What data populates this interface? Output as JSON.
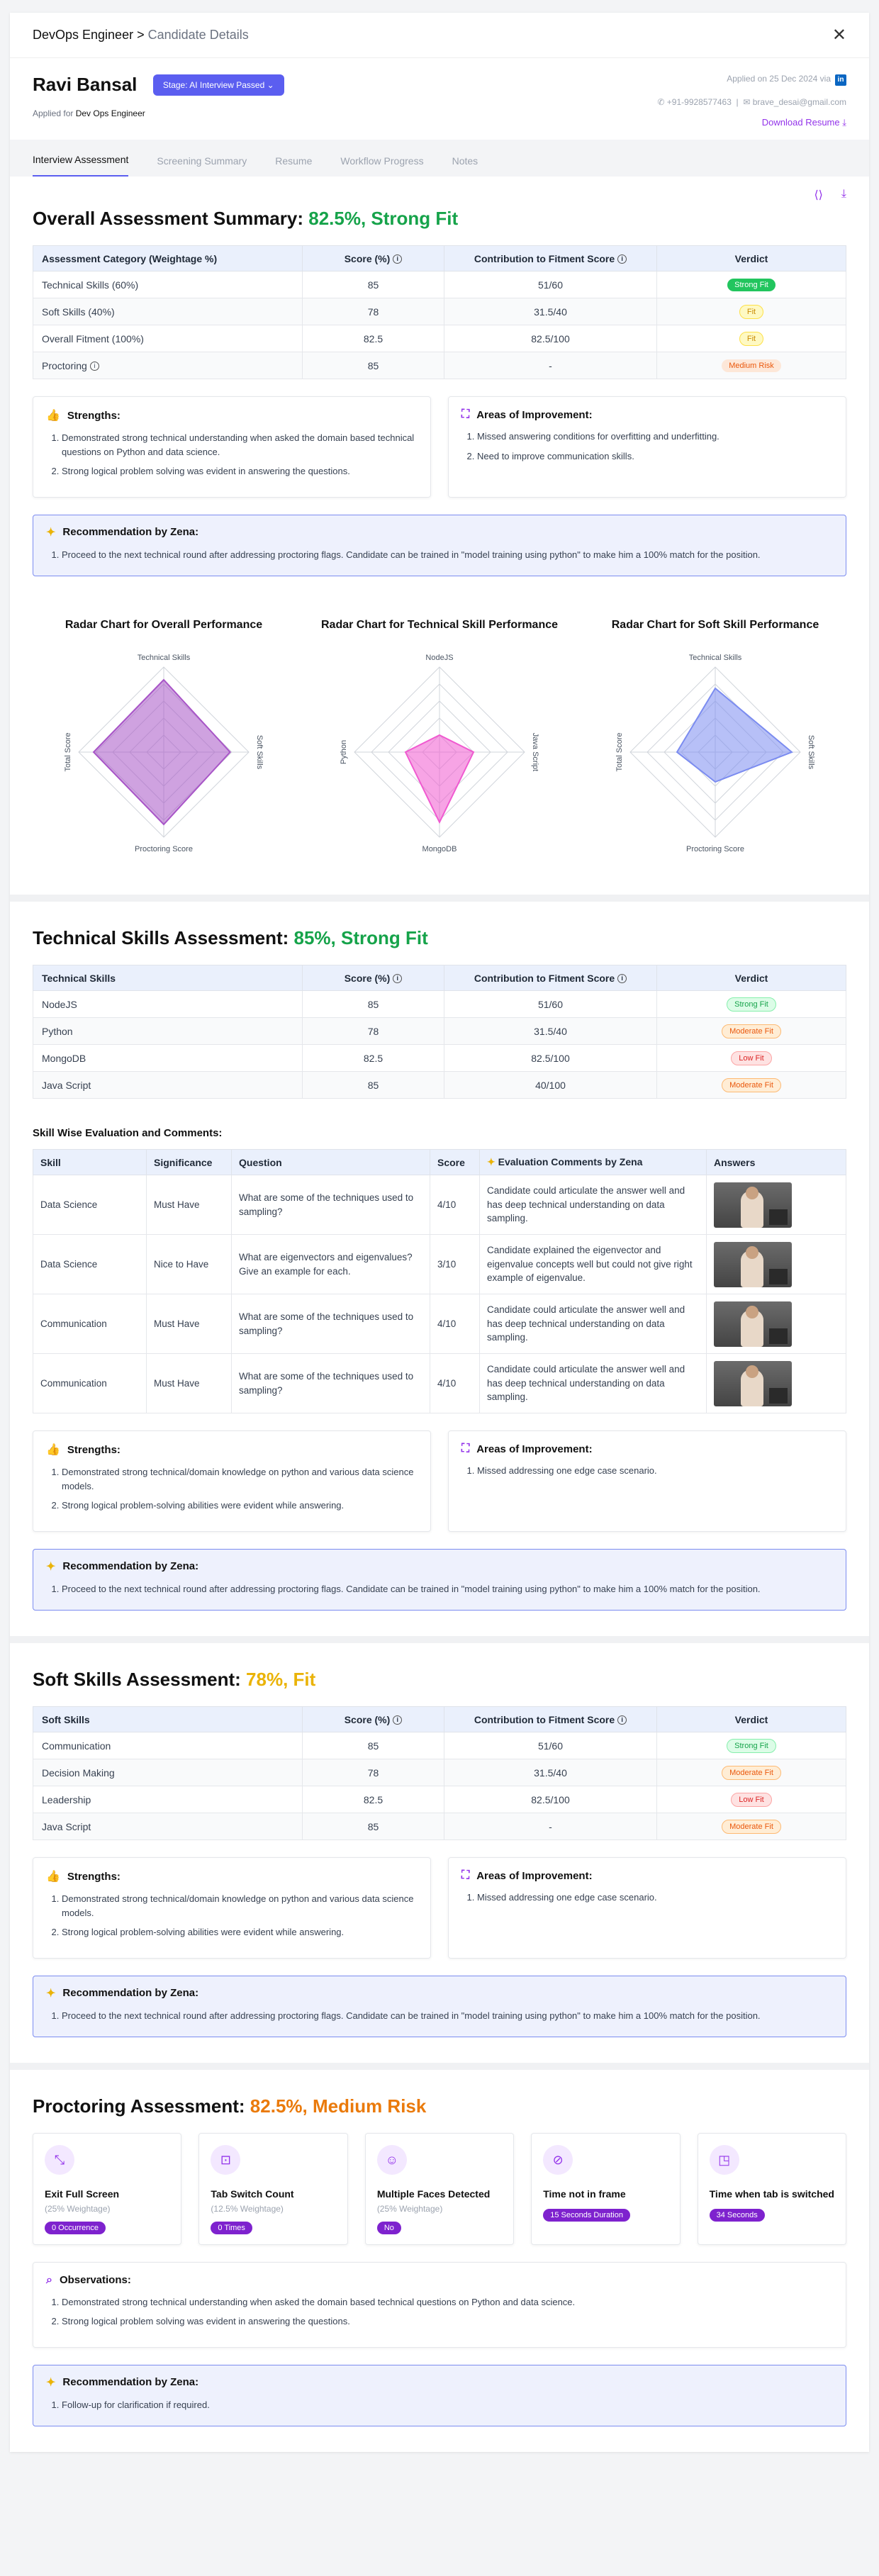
{
  "header": {
    "crumb": "DevOps Engineer",
    "crumb_sep": ">",
    "crumb_current": "Candidate Details"
  },
  "candidate": {
    "name": "Ravi Bansal",
    "stage": "Stage: AI Interview Passed",
    "applied_for_label": "Applied for",
    "applied_for": "Dev Ops Engineer",
    "applied_on": "Applied on 25 Dec 2024 via",
    "phone": "+91-9928577463",
    "email": "brave_desai@gmail.com",
    "download": "Download Resume"
  },
  "tabs": [
    "Interview Assessment",
    "Screening Summary",
    "Resume",
    "Workflow Progress",
    "Notes"
  ],
  "overall": {
    "title": "Overall Assessment Summary:",
    "score": "82.5%, Strong Fit",
    "headers": [
      "Assessment Category (Weightage %)",
      "Score (%)",
      "Contribution to Fitment Score",
      "Verdict"
    ],
    "rows": [
      [
        "Technical Skills (60%)",
        "85",
        "51/60",
        "Strong Fit"
      ],
      [
        "Soft Skills (40%)",
        "78",
        "31.5/40",
        "Fit"
      ],
      [
        "Overall Fitment (100%)",
        "82.5",
        "82.5/100",
        "Fit"
      ],
      [
        "Proctoring",
        "85",
        "-",
        "Medium Risk"
      ]
    ],
    "strengths_title": "Strengths:",
    "strengths": [
      "Demonstrated strong technical understanding when asked the domain based technical questions on Python and data science.",
      "Strong logical problem solving was evident in answering the questions."
    ],
    "improve_title": "Areas of Improvement:",
    "improve": [
      "Missed answering conditions for overfitting and underfitting.",
      "Need to improve communication skills."
    ],
    "rec_title": "Recommendation by Zena:",
    "rec": [
      "Proceed to the next technical round after addressing proctoring flags. Candidate can be trained in \"model training using python\" to make him a 100% match for the position."
    ]
  },
  "radars": [
    {
      "title": "Radar Chart for Overall Performance",
      "axes": [
        "Technical Skills",
        "Soft Skills",
        "Proctoring Score",
        "Total Score"
      ],
      "values": [
        85,
        78,
        85,
        82.5
      ],
      "color": "#a855c7"
    },
    {
      "title": "Radar Chart for Technical Skill Performance",
      "axes": [
        "NodeJS",
        "Java Script",
        "MongoDB",
        "Python"
      ],
      "values": [
        20,
        40,
        82.5,
        40
      ],
      "color": "#f05ad0"
    },
    {
      "title": "Radar Chart for Soft Skill Performance",
      "axes": [
        "Technical Skills",
        "Soft Skills",
        "Proctoring Score",
        "Total Score"
      ],
      "values": [
        75,
        90,
        35,
        45
      ],
      "color": "#7b8cf0"
    }
  ],
  "tech": {
    "title": "Technical Skills Assessment:",
    "score": "85%, Strong Fit",
    "headers": [
      "Technical Skills",
      "Score (%)",
      "Contribution to Fitment Score",
      "Verdict"
    ],
    "rows": [
      [
        "NodeJS",
        "85",
        "51/60",
        "Strong Fit"
      ],
      [
        "Python",
        "78",
        "31.5/40",
        "Moderate Fit"
      ],
      [
        "MongoDB",
        "82.5",
        "82.5/100",
        "Low Fit"
      ],
      [
        "Java Script",
        "85",
        "40/100",
        "Moderate Fit"
      ]
    ],
    "sw_title": "Skill Wise Evaluation and Comments:",
    "sw_headers": [
      "Skill",
      "Significance",
      "Question",
      "Score",
      "Evaluation Comments by Zena",
      "Answers"
    ],
    "sw_rows": [
      [
        "Data Science",
        "Must Have",
        "What are some of the techniques used to sampling?",
        "4/10",
        "Candidate could articulate the answer well and has deep technical understanding on data sampling."
      ],
      [
        "Data Science",
        "Nice to Have",
        "What are eigenvectors and eigenvalues? Give an example for each.",
        "3/10",
        "Candidate explained the eigenvector and eigenvalue concepts well but could not give right example of eigenvalue."
      ],
      [
        "Communication",
        "Must Have",
        "What are some of the techniques used to sampling?",
        "4/10",
        "Candidate could articulate the answer well and has deep technical understanding on data sampling."
      ],
      [
        "Communication",
        "Must Have",
        "What are some of the techniques used to sampling?",
        "4/10",
        "Candidate could articulate the answer well and has deep technical understanding on data sampling."
      ]
    ],
    "strengths_title": "Strengths:",
    "strengths": [
      "Demonstrated strong technical/domain knowledge on python and various data science models.",
      "Strong logical problem-solving abilities were evident while answering."
    ],
    "improve_title": "Areas of Improvement:",
    "improve": [
      "Missed addressing one edge case scenario."
    ],
    "rec_title": "Recommendation by Zena:",
    "rec": [
      "Proceed to the next technical round after addressing proctoring flags. Candidate can be trained in \"model training using python\" to make him a 100% match for the position."
    ]
  },
  "soft": {
    "title": "Soft Skills Assessment:",
    "score": "78%, Fit",
    "headers": [
      "Soft Skills",
      "Score (%)",
      "Contribution to Fitment Score",
      "Verdict"
    ],
    "rows": [
      [
        "Communication",
        "85",
        "51/60",
        "Strong Fit"
      ],
      [
        "Decision Making",
        "78",
        "31.5/40",
        "Moderate Fit"
      ],
      [
        "Leadership",
        "82.5",
        "82.5/100",
        "Low Fit"
      ],
      [
        "Java Script",
        "85",
        "-",
        "Moderate Fit"
      ]
    ],
    "strengths_title": "Strengths:",
    "strengths": [
      "Demonstrated strong technical/domain knowledge on python and various data science models.",
      "Strong logical problem-solving abilities were evident while answering."
    ],
    "improve_title": "Areas of Improvement:",
    "improve": [
      "Missed addressing one edge case scenario."
    ],
    "rec_title": "Recommendation by Zena:",
    "rec": [
      "Proceed to the next technical round after addressing proctoring flags. Candidate can be trained in \"model training using python\" to make him a 100% match for the position."
    ]
  },
  "proctor": {
    "title": "Proctoring Assessment:",
    "score": "82.5%, Medium Risk",
    "cards": [
      {
        "title": "Exit Full Screen",
        "weight": "(25% Weightage)",
        "badge": "0 Occurrence",
        "icon": "⤡"
      },
      {
        "title": "Tab Switch Count",
        "weight": "(12.5% Weightage)",
        "badge": "0 Times",
        "icon": "⊡"
      },
      {
        "title": "Multiple Faces Detected",
        "weight": "(25% Weightage)",
        "badge": "No",
        "icon": "☺"
      },
      {
        "title": "Time not in frame",
        "weight": "",
        "badge": "15 Seconds Duration",
        "icon": "⊘"
      },
      {
        "title": "Time when tab is switched",
        "weight": "",
        "badge": "34 Seconds",
        "icon": "◳"
      }
    ],
    "obs_title": "Observations:",
    "obs": [
      "Demonstrated strong technical understanding when asked the domain based technical questions on Python and data science.",
      "Strong logical problem solving was evident in answering the questions."
    ],
    "rec_title": "Recommendation by Zena:",
    "rec": [
      "Follow-up for clarification if required."
    ]
  }
}
